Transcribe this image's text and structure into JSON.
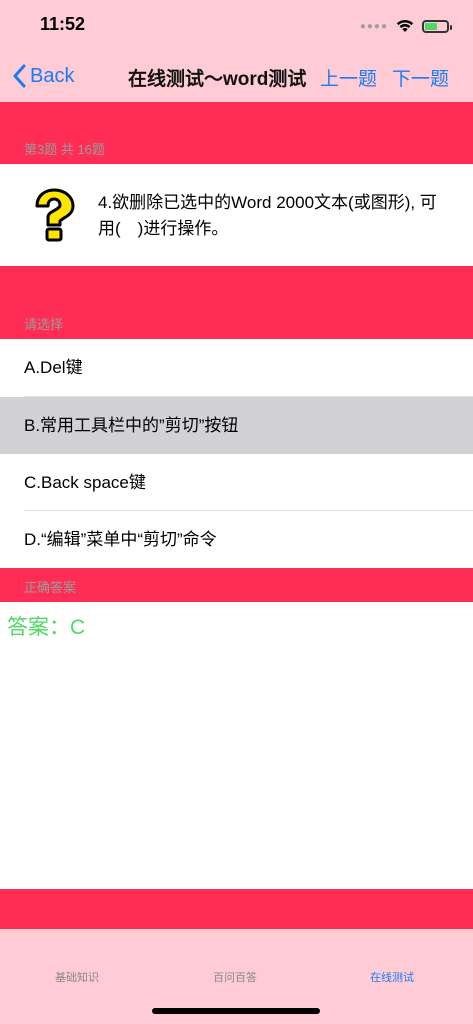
{
  "status": {
    "time": "11:52"
  },
  "nav": {
    "back_label": "Back",
    "title": "在线测试～word测试",
    "prev_label": "上一题",
    "next_label": "下一题"
  },
  "question": {
    "header": "第3题 共 16题",
    "text": "4.欲删除已选中的Word 2000文本(或图形), 可用(　)进行操作。"
  },
  "options": {
    "header": "请选择",
    "items": [
      {
        "label": "A.Del键"
      },
      {
        "label": "B.常用工具栏中的”剪切”按钮"
      },
      {
        "label": "C.Back space键"
      },
      {
        "label": "D.“编辑”菜单中“剪切”命令"
      }
    ],
    "selected_index": 1
  },
  "answer": {
    "header": "正确答案",
    "text": "答案：C"
  },
  "tabs": [
    {
      "label": "基础知识"
    },
    {
      "label": "百问百答"
    },
    {
      "label": "在线测试"
    }
  ],
  "colors": {
    "accent": "#1a7cf5",
    "band": "#ff2d55",
    "bar_bg": "#ffccd5",
    "answer": "#4cd964"
  }
}
